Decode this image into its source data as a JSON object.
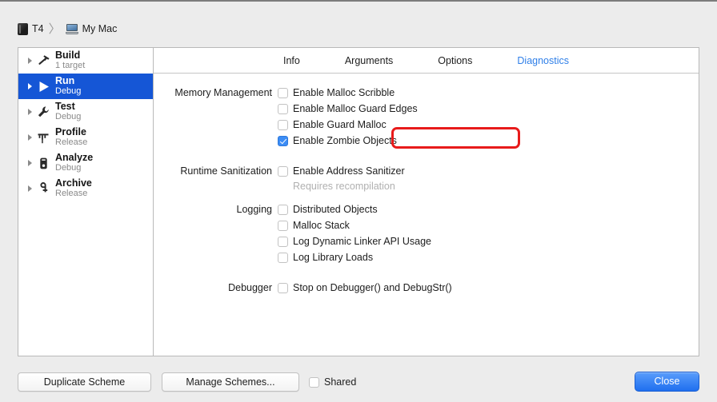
{
  "breadcrumb": {
    "app_icon": "app-icon",
    "scheme_name": "T4",
    "separator": "〉",
    "destination_icon": "mac-laptop-icon",
    "destination": "My Mac"
  },
  "sidebar": {
    "items": [
      {
        "title": "Build",
        "subtitle": "1 target",
        "icon": "hammer-icon",
        "selected": false
      },
      {
        "title": "Run",
        "subtitle": "Debug",
        "icon": "play-icon",
        "selected": true
      },
      {
        "title": "Test",
        "subtitle": "Debug",
        "icon": "wrench-icon",
        "selected": false
      },
      {
        "title": "Profile",
        "subtitle": "Release",
        "icon": "gauge-icon",
        "selected": false
      },
      {
        "title": "Analyze",
        "subtitle": "Debug",
        "icon": "microscope-icon",
        "selected": false
      },
      {
        "title": "Archive",
        "subtitle": "Release",
        "icon": "archive-icon",
        "selected": false
      }
    ]
  },
  "tabs": [
    {
      "label": "Info",
      "active": false
    },
    {
      "label": "Arguments",
      "active": false
    },
    {
      "label": "Options",
      "active": false
    },
    {
      "label": "Diagnostics",
      "active": true
    }
  ],
  "form": {
    "memory_management": {
      "label": "Memory Management",
      "options": [
        {
          "label": "Enable Malloc Scribble",
          "checked": false
        },
        {
          "label": "Enable Malloc Guard Edges",
          "checked": false
        },
        {
          "label": "Enable Guard Malloc",
          "checked": false
        },
        {
          "label": "Enable Zombie Objects",
          "checked": true
        }
      ]
    },
    "runtime_sanitization": {
      "label": "Runtime Sanitization",
      "options": [
        {
          "label": "Enable Address Sanitizer",
          "checked": false
        }
      ],
      "hint": "Requires recompilation"
    },
    "logging": {
      "label": "Logging",
      "options": [
        {
          "label": "Distributed Objects",
          "checked": false
        },
        {
          "label": "Malloc Stack",
          "checked": false
        },
        {
          "label": "Log Dynamic Linker API Usage",
          "checked": false
        },
        {
          "label": "Log Library Loads",
          "checked": false
        }
      ]
    },
    "debugger": {
      "label": "Debugger",
      "options": [
        {
          "label": "Stop on Debugger() and DebugStr()",
          "checked": false
        }
      ]
    }
  },
  "footer": {
    "duplicate_scheme": "Duplicate Scheme",
    "manage_schemes": "Manage Schemes...",
    "shared_label": "Shared",
    "shared_checked": false,
    "close": "Close"
  },
  "annotation": {
    "type": "red-highlight-rectangle",
    "target": "Enable Zombie Objects",
    "color": "#e81b1b"
  },
  "colors": {
    "selection_blue": "#1556d6",
    "accent_blue": "#2f7fe8",
    "checkbox_blue": "#3b8cf5",
    "default_button_blue": "#1f6fef",
    "window_bg": "#ececec",
    "panel_bg": "#ffffff",
    "hint_gray": "#b0b0b0"
  }
}
